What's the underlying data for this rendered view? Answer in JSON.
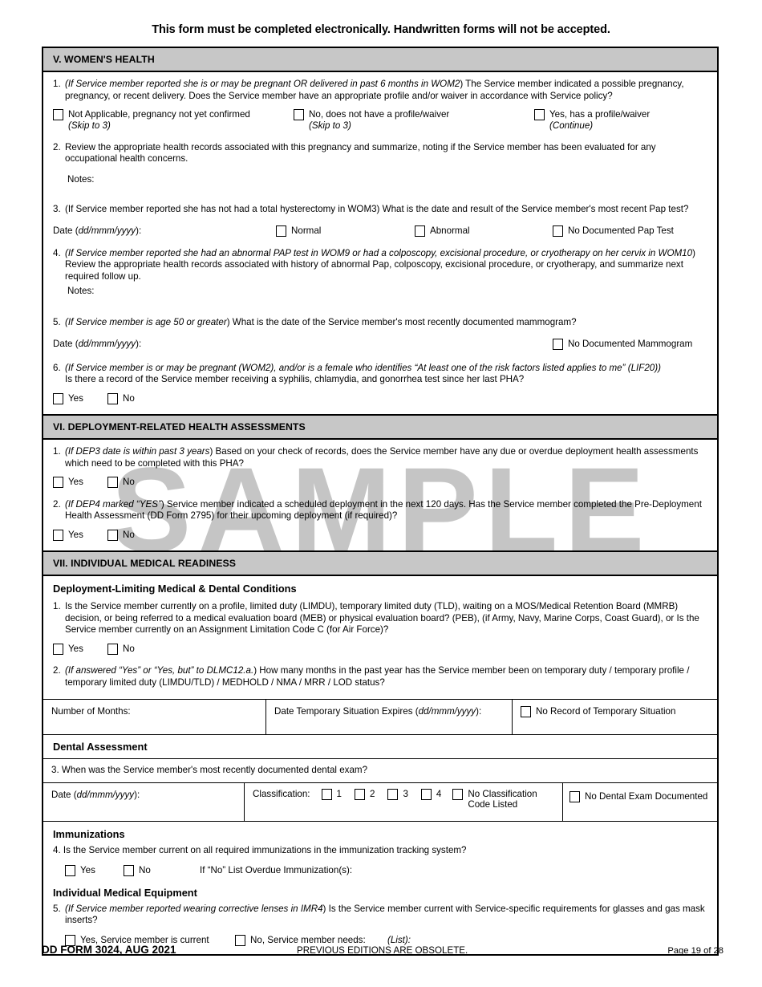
{
  "notice": "This form must be completed electronically. Handwritten forms will not be accepted.",
  "watermark": "SAMPLE",
  "sections": {
    "women": {
      "header": "V. WOMEN'S HEALTH",
      "q1": {
        "num": "1.",
        "italic_lead": "(If Service member reported she is or may be pregnant OR delivered in past 6 months in WOM2",
        "text": ") The Service member indicated a possible pregnancy, pregnancy, or recent delivery. Does the Service member have an appropriate profile and/or waiver in accordance with Service policy?",
        "options": [
          {
            "label": "Not Applicable, pregnancy not yet confirmed",
            "sub": "(Skip to 3)"
          },
          {
            "label": "No, does not have a profile/waiver",
            "sub": "(Skip to 3)"
          },
          {
            "label": "Yes, has a profile/waiver",
            "sub": "(Continue)"
          }
        ]
      },
      "q2": {
        "num": "2.",
        "text": "Review the appropriate health records associated with this pregnancy and summarize, noting if the Service member has been evaluated for any occupational health concerns.",
        "notes_label": "Notes:"
      },
      "q3": {
        "num": "3.",
        "text": "(If Service member reported she has not had a total hysterectomy in WOM3) What is the date and result of the Service member's most recent Pap test?",
        "date_label": "Date (",
        "date_format": "dd/mmm/yyyy",
        "date_suffix": "):",
        "options": [
          "Normal",
          "Abnormal",
          "No Documented Pap Test"
        ]
      },
      "q4": {
        "num": "4.",
        "italic_lead": "(If Service member reported she had an abnormal PAP test in WOM9 or had a colposcopy, excisional procedure, or cryotherapy on her cervix in WOM10",
        "text": ") Review the appropriate health records associated with history of abnormal Pap, colposcopy, excisional procedure, or cryotherapy, and summarize next required follow up.",
        "notes_label": "Notes:"
      },
      "q5": {
        "num": "5.",
        "italic_lead": "(If Service member is age 50 or greater",
        "text": ") What is the date of the Service member's most recently documented mammogram?",
        "date_label": "Date (",
        "date_format": "dd/mmm/yyyy",
        "date_suffix": "):",
        "option": "No Documented Mammogram"
      },
      "q6": {
        "num": "6.",
        "line1_a": "(If Service member is or may be pregnant (WOM2), and/or is a female who identifies “At least one of the risk factors listed applies to me” (LIF20))",
        "line2": "Is there a record of the Service member receiving a syphilis, chlamydia, and gonorrhea test since her last PHA?",
        "yes": "Yes",
        "no": "No"
      }
    },
    "deployment": {
      "header": "VI. DEPLOYMENT-RELATED HEALTH ASSESSMENTS",
      "q1": {
        "num": "1.",
        "italic_lead": "(If DEP3 date is within past 3 years",
        "text": ") Based on your check of records, does the Service member have any due or overdue deployment health assessments which need to be completed with this PHA?",
        "yes": "Yes",
        "no": "No"
      },
      "q2": {
        "num": "2.",
        "italic_lead": "(If DEP4 marked “YES”",
        "text": ") Service member indicated a scheduled deployment in the next 120 days. Has the Service member completed the Pre-Deployment Health Assessment (DD Form 2795) for their upcoming deployment (if required)?",
        "yes": "Yes",
        "no": "No"
      }
    },
    "imr": {
      "header": "VII. INDIVIDUAL MEDICAL READINESS",
      "sub1": "Deployment-Limiting Medical & Dental Conditions",
      "q1": {
        "num": "1.",
        "text": "Is the Service member currently on a profile, limited duty (LIMDU), temporary limited duty (TLD), waiting on a MOS/Medical Retention Board (MMRB) decision, or being referred to a medical evaluation board (MEB) or physical evaluation board? (PEB), (if Army, Navy, Marine Corps, Coast Guard), or Is the Service member currently on an Assignment Limitation Code C (for Air Force)?",
        "yes": "Yes",
        "no": "No"
      },
      "q2": {
        "num": "2.",
        "italic_lead": "(If answered “Yes” or “Yes, but” to DLMC12.a.",
        "text": ") How many months in the past year has the Service member been on temporary duty / temporary profile / temporary limited duty (LIMDU/TLD) / MEDHOLD / NMA / MRR / LOD status?"
      },
      "temp_row": {
        "months_label": "Number of Months:",
        "expires_label": "Date Temporary Situation Expires (",
        "expires_format": "dd/mmm/yyyy",
        "expires_suffix": "):",
        "no_record": "No Record of Temporary Situation"
      },
      "sub2": "Dental Assessment",
      "q3": {
        "num": "3.",
        "text": "When was the Service member's most recently documented dental exam?"
      },
      "dental_row": {
        "date_label": "Date (",
        "date_format": "dd/mmm/yyyy",
        "date_suffix": "):",
        "classification_label": "Classification:",
        "codes": [
          "1",
          "2",
          "3",
          "4"
        ],
        "no_code_line1": "No Classification",
        "no_code_line2": "Code Listed",
        "no_exam": "No Dental Exam Documented"
      },
      "sub3": "Immunizations",
      "q4": {
        "num": "4.",
        "text": "Is the Service member current on all required immunizations in the immunization tracking system?",
        "yes": "Yes",
        "no": "No",
        "list_label": "If “No” List Overdue Immunization(s):"
      },
      "sub4": "Individual Medical Equipment",
      "q5": {
        "num": "5.",
        "italic_lead": "(If Service member reported wearing corrective lenses in IMR4",
        "text": ") Is the Service member current with Service-specific requirements for glasses and gas mask inserts?",
        "yes_label": "Yes, Service member is current",
        "no_label": "No, Service member needs:",
        "list_label": "(List):"
      }
    }
  },
  "footer": {
    "form_id": "DD FORM 3024, AUG 2021",
    "middle": "PREVIOUS EDITIONS ARE OBSOLETE.",
    "page": "Page 19 of 28"
  }
}
